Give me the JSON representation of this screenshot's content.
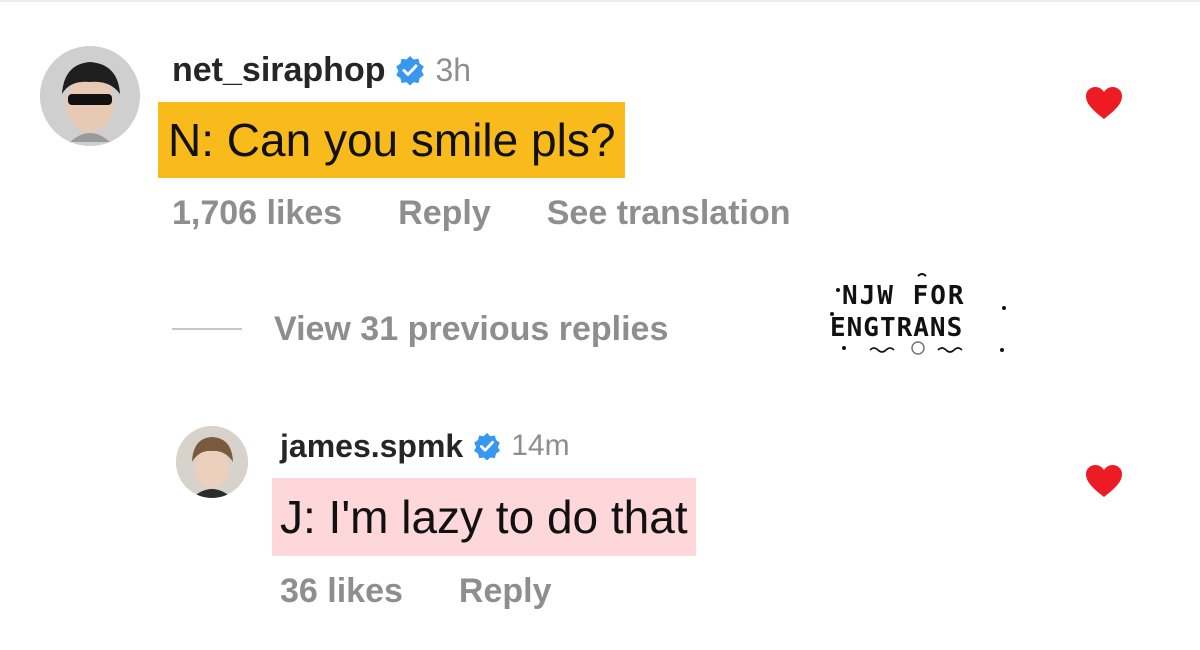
{
  "comment": {
    "username": "net_siraphop",
    "timestamp": "3h",
    "text": "N: Can you smile pls?",
    "likes": "1,706 likes",
    "reply_label": "Reply",
    "translation_label": "See translation",
    "highlight_color": "#f9bb1c",
    "liked": true
  },
  "view_replies": {
    "label": "View 31 previous replies"
  },
  "reply": {
    "username": "james.spmk",
    "timestamp": "14m",
    "text": "J: I'm lazy to do that",
    "likes": "36 likes",
    "reply_label": "Reply",
    "highlight_color": "#fdd7d9",
    "liked": true
  },
  "watermark": {
    "line1": "NJW FOR",
    "line2": "ENGTRANS"
  },
  "colors": {
    "heart": "#ed1c24",
    "verified": "#3897f0",
    "meta_text": "#8e8e8e"
  }
}
